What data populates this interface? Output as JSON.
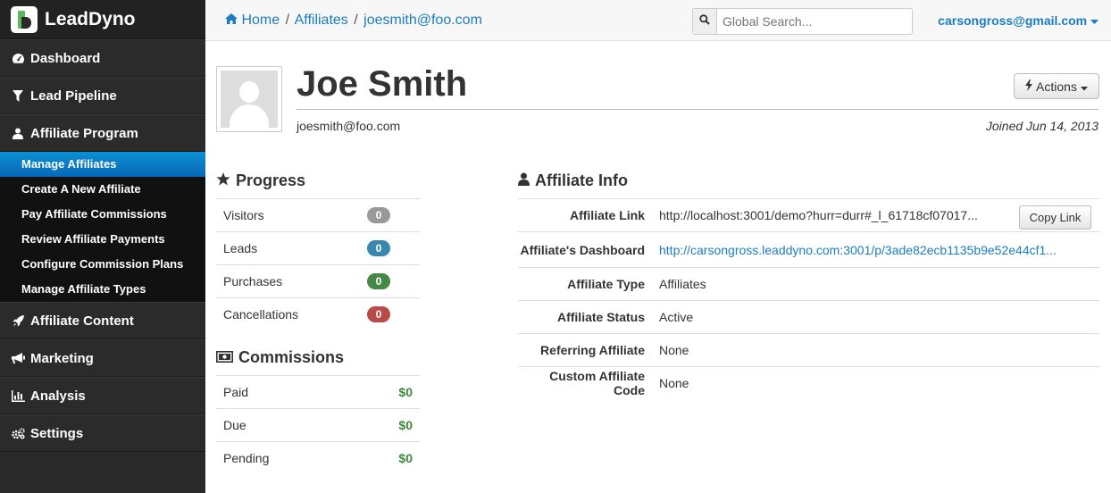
{
  "brand": {
    "name": "LeadDyno"
  },
  "sidebar": {
    "items": [
      {
        "label": "Dashboard",
        "icon": "dashboard-icon"
      },
      {
        "label": "Lead Pipeline",
        "icon": "filter-icon"
      },
      {
        "label": "Affiliate Program",
        "icon": "user-icon"
      },
      {
        "label": "Affiliate Content",
        "icon": "rocket-icon"
      },
      {
        "label": "Marketing",
        "icon": "bullhorn-icon"
      },
      {
        "label": "Analysis",
        "icon": "bar-chart-icon"
      },
      {
        "label": "Settings",
        "icon": "cogs-icon"
      }
    ],
    "subitems": [
      {
        "label": "Manage Affiliates",
        "active": true
      },
      {
        "label": "Create A New Affiliate"
      },
      {
        "label": "Pay Affiliate Commissions"
      },
      {
        "label": "Review Affiliate Payments"
      },
      {
        "label": "Configure Commission Plans"
      },
      {
        "label": "Manage Affiliate Types"
      }
    ]
  },
  "topbar": {
    "breadcrumbs": [
      "Home",
      "Affiliates",
      "joesmith@foo.com"
    ],
    "search_placeholder": "Global Search...",
    "user": "carsongross@gmail.com"
  },
  "profile": {
    "name": "Joe Smith",
    "email": "joesmith@foo.com",
    "joined": "Joined Jun 14, 2013",
    "actions_label": "Actions"
  },
  "progress": {
    "title": "Progress",
    "rows": [
      {
        "label": "Visitors",
        "count": "0",
        "color": "#999999"
      },
      {
        "label": "Leads",
        "count": "0",
        "color": "#3a87ad"
      },
      {
        "label": "Purchases",
        "count": "0",
        "color": "#468847"
      },
      {
        "label": "Cancellations",
        "count": "0",
        "color": "#b94a48"
      }
    ]
  },
  "commissions": {
    "title": "Commissions",
    "rows": [
      {
        "label": "Paid",
        "amount": "$0"
      },
      {
        "label": "Due",
        "amount": "$0"
      },
      {
        "label": "Pending",
        "amount": "$0"
      }
    ]
  },
  "affiliate_info": {
    "title": "Affiliate Info",
    "copy_label": "Copy Link",
    "rows": [
      {
        "label": "Affiliate Link",
        "value": "http://localhost:3001/demo?hurr=durr#_l_61718cf07017..."
      },
      {
        "label": "Affiliate's Dashboard",
        "value": "http://carsongross.leaddyno.com:3001/p/3ade82ecb1135b9e52e44cf1..."
      },
      {
        "label": "Affiliate Type",
        "value": "Affiliates"
      },
      {
        "label": "Affiliate Status",
        "value": "Active"
      },
      {
        "label": "Referring Affiliate",
        "value": "None"
      },
      {
        "label": "Custom Affiliate Code",
        "value": "None"
      }
    ]
  }
}
